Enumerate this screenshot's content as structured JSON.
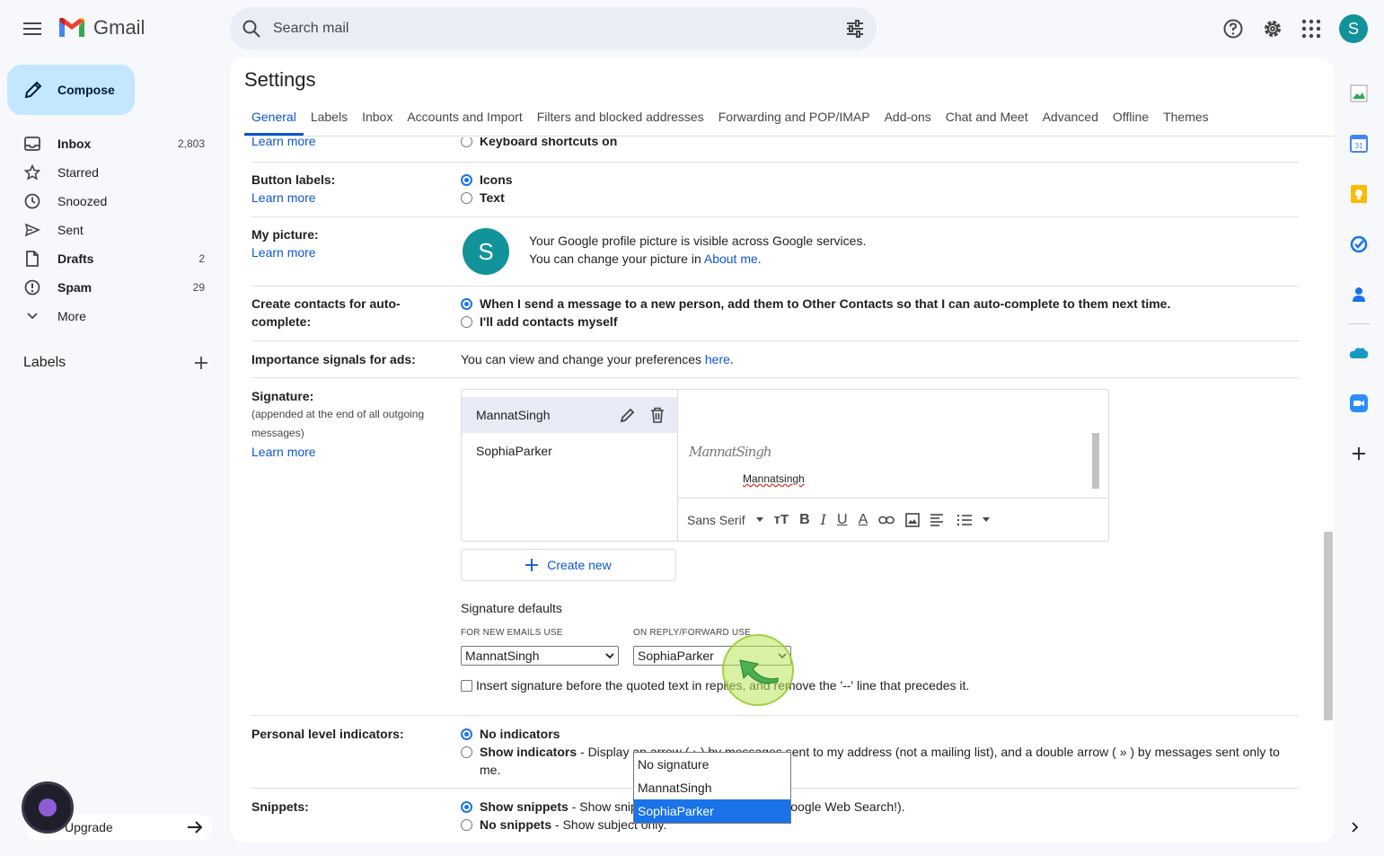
{
  "app": {
    "name": "Gmail"
  },
  "search": {
    "placeholder": "Search mail"
  },
  "account": {
    "initial": "S"
  },
  "compose": {
    "label": "Compose"
  },
  "nav": [
    {
      "label": "Inbox",
      "count": "2,803",
      "bold": true,
      "icon": "inbox-icon"
    },
    {
      "label": "Starred",
      "count": "",
      "bold": false,
      "icon": "star-icon"
    },
    {
      "label": "Snoozed",
      "count": "",
      "bold": false,
      "icon": "clock-icon"
    },
    {
      "label": "Sent",
      "count": "",
      "bold": false,
      "icon": "send-icon"
    },
    {
      "label": "Drafts",
      "count": "2",
      "bold": true,
      "icon": "draft-icon"
    },
    {
      "label": "Spam",
      "count": "29",
      "bold": true,
      "icon": "spam-icon"
    },
    {
      "label": "More",
      "count": "",
      "bold": false,
      "icon": "chevron-down-icon"
    }
  ],
  "labels_header": "Labels",
  "upgrade": {
    "label": "Upgrade"
  },
  "settings": {
    "title": "Settings",
    "tabs": [
      "General",
      "Labels",
      "Inbox",
      "Accounts and Import",
      "Filters and blocked addresses",
      "Forwarding and POP/IMAP",
      "Add-ons",
      "Chat and Meet",
      "Advanced",
      "Offline",
      "Themes"
    ],
    "active_tab": "General",
    "learn_more": "Learn more",
    "keyboard": {
      "option_on": "Keyboard shortcuts on"
    },
    "button_labels": {
      "label": "Button labels:",
      "opt1": "Icons",
      "opt2": "Text"
    },
    "my_picture": {
      "label": "My picture:",
      "initial": "S",
      "line1": "Your Google profile picture is visible across Google services.",
      "line2_prefix": "You can change your picture in ",
      "line2_link": "About me",
      "line2_suffix": "."
    },
    "contacts": {
      "label": "Create contacts for auto-complete:",
      "opt1": "When I send a message to a new person, add them to Other Contacts so that I can auto-complete to them next time.",
      "opt2": "I'll add contacts myself"
    },
    "importance": {
      "label": "Importance signals for ads:",
      "text_prefix": "You can view and change your preferences ",
      "link": "here",
      "text_suffix": "."
    },
    "signature": {
      "label": "Signature:",
      "sub": "(appended at the end of all outgoing messages)",
      "items": [
        "MannatSingh",
        "SophiaParker"
      ],
      "handwriting": "MannatSingh",
      "name_text": "Mannatsingh",
      "font": "Sans Serif",
      "create_new": "Create new",
      "defaults_title": "Signature defaults",
      "new_emails_label": "FOR NEW EMAILS USE",
      "reply_label": "ON REPLY/FORWARD USE",
      "new_emails_value": "MannatSingh",
      "reply_value": "SophiaParker",
      "insert_before": "Insert signature before the quoted text in replies, and remove the '--' line that precedes it."
    },
    "personal": {
      "label": "Personal level indicators:",
      "opt1": "No indicators",
      "opt2_b": "Show indicators",
      "opt2": " - Display an arrow ( › ) by messages sent to my address (not a mailing list), and a double arrow ( » ) by messages sent only to me."
    },
    "snippets": {
      "label": "Snippets:",
      "opt1_b": "Show snippets",
      "opt1": " - Show snippets of the message (like Google Web Search!).",
      "opt2_b": "No snippets",
      "opt2": " - Show subject only."
    }
  },
  "dropdown_options": [
    "No signature",
    "MannatSingh",
    "SophiaParker"
  ],
  "dropdown_selected": "SophiaParker",
  "colors": {
    "accent": "#0b57d0",
    "compose_bg": "#c2e7ff",
    "avatar": "#12939a",
    "highlight": "#1a73e8"
  }
}
